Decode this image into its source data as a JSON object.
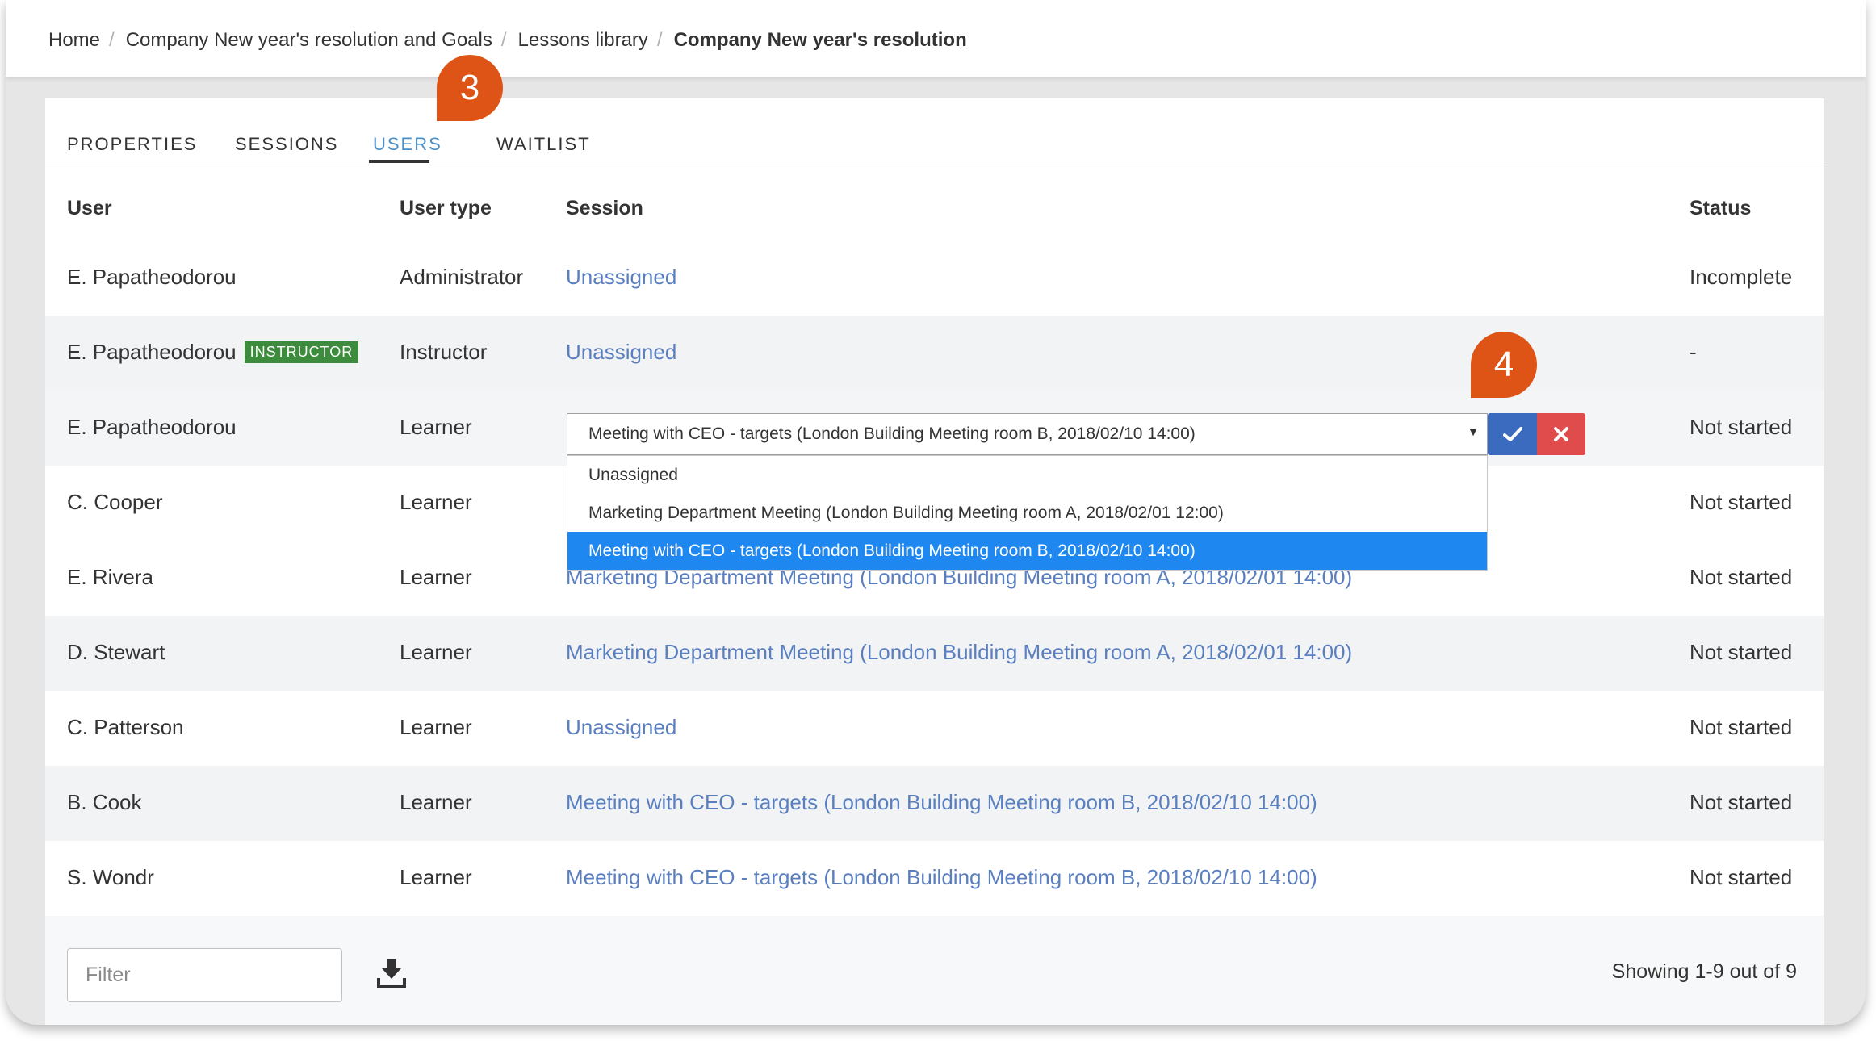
{
  "breadcrumb": {
    "items": [
      "Home",
      "Company New year's resolution and Goals",
      "Lessons library"
    ],
    "separator": "/",
    "current": "Company New year's resolution"
  },
  "tabs": [
    {
      "label": "PROPERTIES",
      "active": false
    },
    {
      "label": "SESSIONS",
      "active": false
    },
    {
      "label": "USERS",
      "active": true
    },
    {
      "label": "WAITLIST",
      "active": false
    }
  ],
  "table": {
    "headers": {
      "user": "User",
      "user_type": "User type",
      "session": "Session",
      "status": "Status"
    },
    "rows": [
      {
        "user": "E. Papatheodorou",
        "badge": "",
        "user_type": "Administrator",
        "session": "Unassigned",
        "status": "Incomplete"
      },
      {
        "user": "E. Papatheodorou",
        "badge": "INSTRUCTOR",
        "user_type": "Instructor",
        "session": "Unassigned",
        "status": "-"
      },
      {
        "user": "E. Papatheodorou",
        "badge": "",
        "user_type": "Learner",
        "session": "Meeting with CEO - targets (London Building Meeting room B, 2018/02/10 14:00)",
        "status": "Not started",
        "editing": true
      },
      {
        "user": "C. Cooper",
        "badge": "",
        "user_type": "Learner",
        "session": "",
        "status": "Not started"
      },
      {
        "user": "E. Rivera",
        "badge": "",
        "user_type": "Learner",
        "session": "Marketing Department Meeting (London Building Meeting room A, 2018/02/01 14:00)",
        "status": "Not started"
      },
      {
        "user": "D. Stewart",
        "badge": "",
        "user_type": "Learner",
        "session": "Marketing Department Meeting (London Building Meeting room A, 2018/02/01 14:00)",
        "status": "Not started"
      },
      {
        "user": "C. Patterson",
        "badge": "",
        "user_type": "Learner",
        "session": "Unassigned",
        "status": "Not started"
      },
      {
        "user": "B. Cook",
        "badge": "",
        "user_type": "Learner",
        "session": "Meeting with CEO - targets (London Building Meeting room B, 2018/02/10 14:00)",
        "status": "Not started"
      },
      {
        "user": "S. Wondr",
        "badge": "",
        "user_type": "Learner",
        "session": "Meeting with CEO - targets (London Building Meeting room B, 2018/02/10 14:00)",
        "status": "Not started"
      }
    ]
  },
  "session_select": {
    "value": "Meeting with CEO - targets (London Building Meeting room B, 2018/02/10 14:00)",
    "arrow": "▼",
    "options": [
      {
        "label": "Unassigned",
        "selected": false
      },
      {
        "label": "Marketing Department Meeting (London Building Meeting room A, 2018/02/01 12:00)",
        "selected": false
      },
      {
        "label": "Meeting with CEO - targets (London Building Meeting room B, 2018/02/10 14:00)",
        "selected": true
      }
    ],
    "confirm_icon": "check-icon",
    "cancel_icon": "close-icon"
  },
  "footer": {
    "filter_placeholder": "Filter",
    "download_icon": "download-icon",
    "pager_text": "Showing 1-9 out of 9"
  },
  "annotations": {
    "marker_3": "3",
    "marker_4": "4"
  },
  "colors": {
    "link": "#5a7fc0",
    "active_tab": "#4a90c8",
    "badge_bg": "#3d8b3d",
    "confirm_button": "#3b6bbf",
    "cancel_button": "#e04b4b",
    "selected_option": "#1e87f0",
    "marker": "#de5416"
  }
}
